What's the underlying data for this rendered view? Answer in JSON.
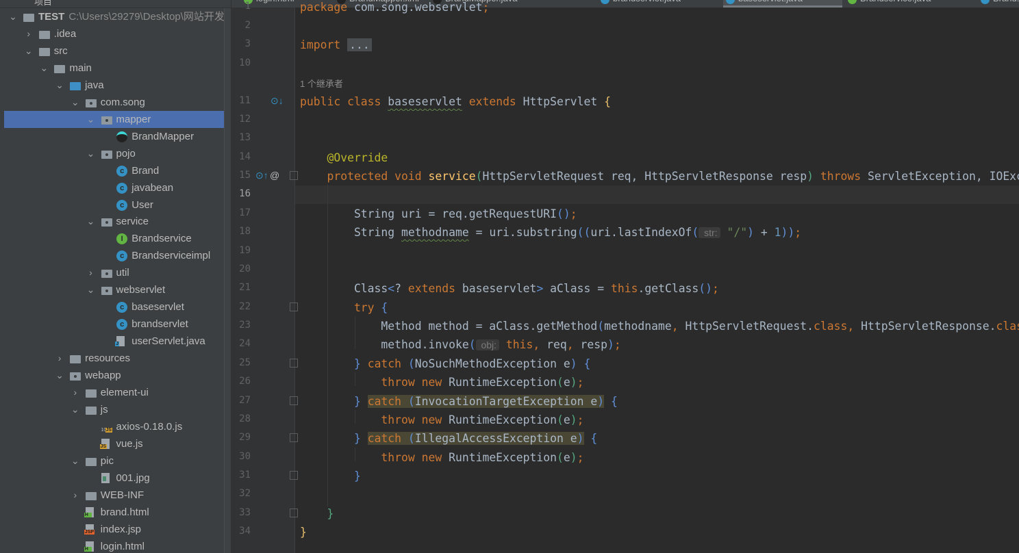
{
  "sidebar": {
    "header": "项目",
    "root": {
      "name": "TEST",
      "path": "C:\\Users\\29279\\Desktop\\网站开发"
    },
    "items": [
      {
        "label": ".idea",
        "level": 1,
        "arrow": "›",
        "icon": "folder"
      },
      {
        "label": "src",
        "level": 1,
        "arrow": "⌄",
        "icon": "folder"
      },
      {
        "label": "main",
        "level": 2,
        "arrow": "⌄",
        "icon": "folder"
      },
      {
        "label": "java",
        "level": 3,
        "arrow": "⌄",
        "icon": "folder-source"
      },
      {
        "label": "com.song",
        "level": 4,
        "arrow": "⌄",
        "icon": "package"
      },
      {
        "label": "mapper",
        "level": 5,
        "arrow": "⌄",
        "icon": "package",
        "selected": true
      },
      {
        "label": "BrandMapper",
        "level": 6,
        "icon": "mybatis-mapper"
      },
      {
        "label": "pojo",
        "level": 5,
        "arrow": "⌄",
        "icon": "package"
      },
      {
        "label": "Brand",
        "level": 6,
        "icon": "class"
      },
      {
        "label": "javabean",
        "level": 6,
        "icon": "class"
      },
      {
        "label": "User",
        "level": 6,
        "icon": "class"
      },
      {
        "label": "service",
        "level": 5,
        "arrow": "⌄",
        "icon": "package"
      },
      {
        "label": "Brandservice",
        "level": 6,
        "icon": "interface"
      },
      {
        "label": "Brandserviceimpl",
        "level": 6,
        "icon": "class"
      },
      {
        "label": "util",
        "level": 5,
        "arrow": "›",
        "icon": "package"
      },
      {
        "label": "webservlet",
        "level": 5,
        "arrow": "⌄",
        "icon": "package"
      },
      {
        "label": "baseservlet",
        "level": 6,
        "icon": "class"
      },
      {
        "label": "brandservlet",
        "level": 6,
        "icon": "class"
      },
      {
        "label": "userServlet.java",
        "level": 6,
        "icon": "java-file"
      },
      {
        "label": "resources",
        "level": 3,
        "arrow": "›",
        "icon": "folder-resources"
      },
      {
        "label": "webapp",
        "level": 3,
        "arrow": "⌄",
        "icon": "folder-web"
      },
      {
        "label": "element-ui",
        "level": 4,
        "arrow": "›",
        "icon": "folder"
      },
      {
        "label": "js",
        "level": 4,
        "arrow": "⌄",
        "icon": "folder"
      },
      {
        "label": "axios-0.18.0.js",
        "level": 5,
        "icon": "js-min-file"
      },
      {
        "label": "vue.js",
        "level": 5,
        "icon": "js-file"
      },
      {
        "label": "pic",
        "level": 4,
        "arrow": "⌄",
        "icon": "folder"
      },
      {
        "label": "001.jpg",
        "level": 5,
        "icon": "image-file"
      },
      {
        "label": "WEB-INF",
        "level": 4,
        "arrow": "›",
        "icon": "folder"
      },
      {
        "label": "brand.html",
        "level": 4,
        "icon": "html-file"
      },
      {
        "label": "index.jsp",
        "level": 4,
        "icon": "jsp-file"
      },
      {
        "label": "login.html",
        "level": 4,
        "icon": "html-file"
      }
    ]
  },
  "tabs": [
    {
      "label": "login.html",
      "color": "#62b543",
      "active": false
    },
    {
      "label": "BrandMapper.xml",
      "color": "#222222",
      "active": false
    },
    {
      "label": "BrandMapper.java",
      "color": "#222222",
      "active": false
    },
    {
      "label": "brandservlet.java",
      "color": "#3592c4",
      "active": false
    },
    {
      "label": "baseservlet.java",
      "color": "#3592c4",
      "active": true
    },
    {
      "label": "Brandservice.java",
      "color": "#62b543",
      "active": false
    },
    {
      "label": "Brand.java",
      "color": "#3592c4",
      "active": false
    }
  ],
  "editor": {
    "current_line": "16",
    "inheritor_hint": "1 个继承者",
    "lines": [
      {
        "n": "1",
        "t": [
          [
            "package ",
            "k"
          ],
          [
            "com.song.webservlet",
            ""
          ],
          [
            ";",
            "k"
          ]
        ]
      },
      {
        "n": "2",
        "t": []
      },
      {
        "n": "3",
        "t": [
          [
            "import ",
            "k"
          ],
          [
            "...",
            "fold"
          ]
        ]
      },
      {
        "n": "10",
        "t": []
      },
      {
        "n": "11",
        "t": [
          [
            "public class ",
            "k"
          ],
          [
            "baseservlet",
            "w"
          ],
          [
            " extends ",
            "k"
          ],
          [
            "HttpServlet ",
            ""
          ],
          [
            "{",
            "y"
          ]
        ]
      },
      {
        "n": "12",
        "t": []
      },
      {
        "n": "13",
        "t": []
      },
      {
        "n": "14",
        "t": [
          [
            "    ",
            ""
          ],
          [
            "@Override",
            "a"
          ]
        ]
      },
      {
        "n": "15",
        "t": [
          [
            "    protected void ",
            "k"
          ],
          [
            "service",
            "f"
          ],
          [
            "(",
            "g"
          ],
          [
            "HttpServletRequest req, HttpServletResponse resp",
            ""
          ],
          [
            ")",
            "g"
          ],
          [
            " throws ",
            "k"
          ],
          [
            "ServletException, IOException ",
            ""
          ],
          [
            "{",
            "g"
          ]
        ]
      },
      {
        "n": "16",
        "t": []
      },
      {
        "n": "17",
        "t": [
          [
            "        String uri = req.getRequestURI",
            ""
          ],
          [
            "()",
            "p"
          ],
          [
            ";",
            "k"
          ]
        ]
      },
      {
        "n": "18",
        "t": [
          [
            "        String ",
            ""
          ],
          [
            "methodname",
            "w"
          ],
          [
            " = uri.substring",
            ""
          ],
          [
            "((",
            "p"
          ],
          [
            "uri.lastIndexOf",
            ""
          ],
          [
            "(",
            "p"
          ],
          [
            " str:",
            "hint"
          ],
          [
            " ",
            ""
          ],
          [
            "\"/\"",
            "s"
          ],
          [
            ")",
            "p"
          ],
          [
            " + ",
            ""
          ],
          [
            "1",
            "n"
          ],
          [
            "))",
            "p"
          ],
          [
            ";",
            "k"
          ]
        ]
      },
      {
        "n": "19",
        "t": []
      },
      {
        "n": "20",
        "t": []
      },
      {
        "n": "21",
        "t": [
          [
            "        Class",
            ""
          ],
          [
            "<",
            "p"
          ],
          [
            "? ",
            ""
          ],
          [
            "extends ",
            "k"
          ],
          [
            "baseservlet",
            ""
          ],
          [
            ">",
            "p"
          ],
          [
            " aClass = ",
            ""
          ],
          [
            "this",
            "k"
          ],
          [
            ".getClass",
            ""
          ],
          [
            "()",
            "p"
          ],
          [
            ";",
            "k"
          ]
        ]
      },
      {
        "n": "22",
        "t": [
          [
            "        try ",
            "k"
          ],
          [
            "{",
            "p"
          ]
        ]
      },
      {
        "n": "23",
        "t": [
          [
            "            Method method = aClass.getMethod",
            ""
          ],
          [
            "(",
            "p"
          ],
          [
            "methodname",
            ""
          ],
          [
            ", ",
            "k"
          ],
          [
            "HttpServletRequest.",
            ""
          ],
          [
            "class",
            "k"
          ],
          [
            ", ",
            "k"
          ],
          [
            "HttpServletResponse.",
            ""
          ],
          [
            "class",
            "k"
          ],
          [
            ")",
            "p"
          ],
          [
            ";",
            "k"
          ]
        ]
      },
      {
        "n": "24",
        "t": [
          [
            "            method.invoke",
            ""
          ],
          [
            "(",
            "p"
          ],
          [
            " obj:",
            "hint"
          ],
          [
            " ",
            ""
          ],
          [
            "this",
            "k"
          ],
          [
            ", ",
            "k"
          ],
          [
            "req",
            ""
          ],
          [
            ", ",
            "k"
          ],
          [
            "resp",
            ""
          ],
          [
            ")",
            "p"
          ],
          [
            ";",
            "k"
          ]
        ]
      },
      {
        "n": "25",
        "t": [
          [
            "        ",
            ""
          ],
          [
            "}",
            "p"
          ],
          [
            " catch ",
            "k"
          ],
          [
            "(",
            "p"
          ],
          [
            "NoSuchMethodException e",
            ""
          ],
          [
            ")",
            "p"
          ],
          [
            " ",
            ""
          ],
          [
            "{",
            "p"
          ]
        ]
      },
      {
        "n": "26",
        "t": [
          [
            "            throw new ",
            "k"
          ],
          [
            "RuntimeException",
            ""
          ],
          [
            "(",
            "g"
          ],
          [
            "e",
            ""
          ],
          [
            ")",
            "g"
          ],
          [
            ";",
            "k"
          ]
        ]
      },
      {
        "n": "27",
        "t": [
          [
            "        ",
            ""
          ],
          [
            "}",
            "p"
          ],
          [
            " ",
            ""
          ],
          [
            "catch ",
            "k hl"
          ],
          [
            "(",
            "p hl"
          ],
          [
            "InvocationTargetException e",
            "hl"
          ],
          [
            ")",
            "p hl"
          ],
          [
            " ",
            ""
          ],
          [
            "{",
            "p"
          ]
        ]
      },
      {
        "n": "28",
        "t": [
          [
            "            throw new ",
            "k"
          ],
          [
            "RuntimeException",
            ""
          ],
          [
            "(",
            "g"
          ],
          [
            "e",
            ""
          ],
          [
            ")",
            "g"
          ],
          [
            ";",
            "k"
          ]
        ]
      },
      {
        "n": "29",
        "t": [
          [
            "        ",
            ""
          ],
          [
            "}",
            "p"
          ],
          [
            " ",
            ""
          ],
          [
            "catch ",
            "k hl"
          ],
          [
            "(",
            "p hl"
          ],
          [
            "IllegalAccessException e",
            "hl"
          ],
          [
            ")",
            "p hl"
          ],
          [
            " ",
            ""
          ],
          [
            "{",
            "p"
          ]
        ]
      },
      {
        "n": "30",
        "t": [
          [
            "            throw new ",
            "k"
          ],
          [
            "RuntimeException",
            ""
          ],
          [
            "(",
            "g"
          ],
          [
            "e",
            ""
          ],
          [
            ")",
            "g"
          ],
          [
            ";",
            "k"
          ]
        ]
      },
      {
        "n": "31",
        "t": [
          [
            "        ",
            ""
          ],
          [
            "}",
            "p"
          ]
        ]
      },
      {
        "n": "32",
        "t": []
      },
      {
        "n": "33",
        "t": [
          [
            "    ",
            ""
          ],
          [
            "}",
            "g"
          ]
        ]
      },
      {
        "n": "34",
        "t": [
          [
            "}",
            "y"
          ]
        ]
      }
    ]
  },
  "colors": {
    "sidebar_bg": "#3c3f41",
    "editor_bg": "#2b2b2b",
    "selection": "#4b6eaf",
    "keyword": "#cc7832"
  }
}
